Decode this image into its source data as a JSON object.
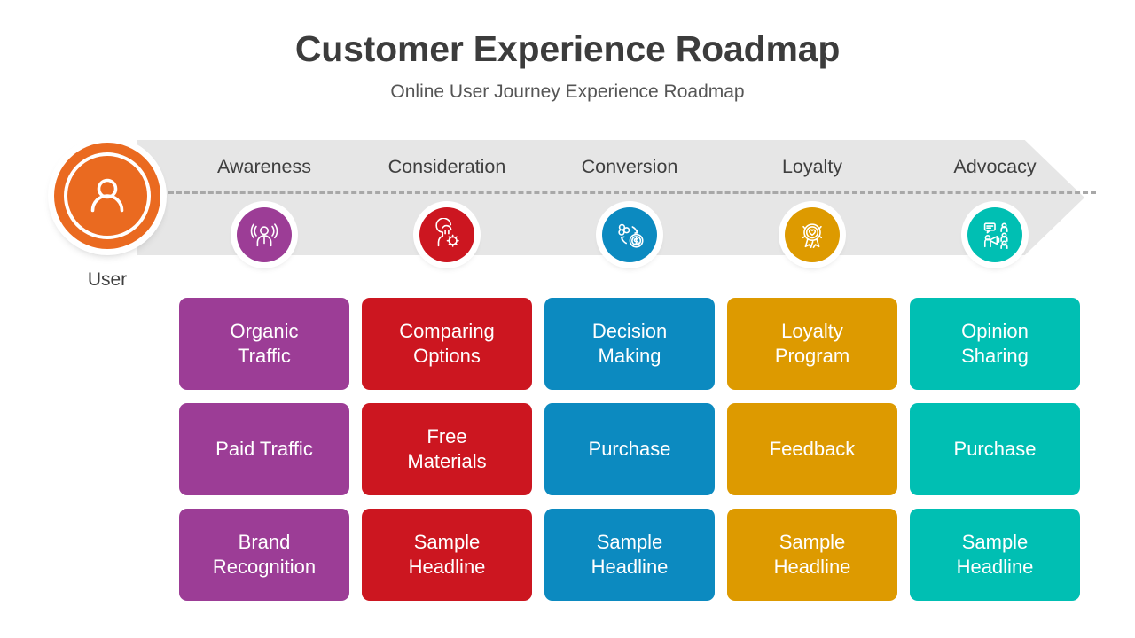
{
  "header": {
    "title": "Customer Experience Roadmap",
    "subtitle": "Online User Journey Experience Roadmap"
  },
  "user": {
    "label": "User",
    "icon": "user-avatar-icon",
    "color": "#ea6a20"
  },
  "banner": {
    "background": "#e6e6e6",
    "dash_color": "#a8a8a8"
  },
  "stages": [
    {
      "label": "Awareness",
      "color": "#9c3d96",
      "icon": "awareness-broadcast-icon"
    },
    {
      "label": "Consideration",
      "color": "#cc1620",
      "icon": "consideration-thinking-gear-icon"
    },
    {
      "label": "Conversion",
      "color": "#0c8ac0",
      "icon": "conversion-money-icon"
    },
    {
      "label": "Loyalty",
      "color": "#dd9a00",
      "icon": "loyalty-award-heart-icon"
    },
    {
      "label": "Advocacy",
      "color": "#00bfb3",
      "icon": "advocacy-megaphone-icon"
    }
  ],
  "rows": [
    [
      {
        "text": "Organic\nTraffic",
        "color": "#9c3d96"
      },
      {
        "text": "Comparing\nOptions",
        "color": "#cc1620"
      },
      {
        "text": "Decision\nMaking",
        "color": "#0c8ac0"
      },
      {
        "text": "Loyalty\nProgram",
        "color": "#dd9a00"
      },
      {
        "text": "Opinion\nSharing",
        "color": "#00bfb3"
      }
    ],
    [
      {
        "text": "Paid Traffic",
        "color": "#9c3d96"
      },
      {
        "text": "Free\nMaterials",
        "color": "#cc1620"
      },
      {
        "text": "Purchase",
        "color": "#0c8ac0"
      },
      {
        "text": "Feedback",
        "color": "#dd9a00"
      },
      {
        "text": "Purchase",
        "color": "#00bfb3"
      }
    ],
    [
      {
        "text": "Brand\nRecognition",
        "color": "#9c3d96"
      },
      {
        "text": "Sample\nHeadline",
        "color": "#cc1620"
      },
      {
        "text": "Sample\nHeadline",
        "color": "#0c8ac0"
      },
      {
        "text": "Sample\nHeadline",
        "color": "#dd9a00"
      },
      {
        "text": "Sample\nHeadline",
        "color": "#00bfb3"
      }
    ]
  ]
}
